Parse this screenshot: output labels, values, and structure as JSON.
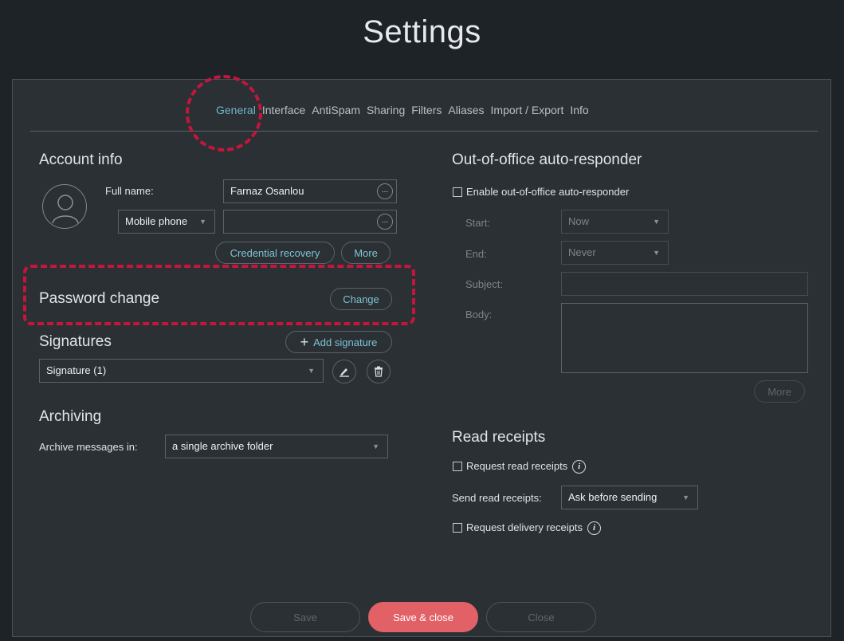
{
  "title": "Settings",
  "tabs": [
    {
      "label": "General",
      "active": true
    },
    {
      "label": "Interface",
      "active": false
    },
    {
      "label": "AntiSpam",
      "active": false
    },
    {
      "label": "Sharing",
      "active": false
    },
    {
      "label": "Filters",
      "active": false
    },
    {
      "label": "Aliases",
      "active": false
    },
    {
      "label": "Import / Export",
      "active": false
    },
    {
      "label": "Info",
      "active": false
    }
  ],
  "account": {
    "heading": "Account info",
    "full_name_label": "Full name:",
    "full_name_value": "Farnaz Osanlou",
    "ellipsis": "...",
    "phone_type": "Mobile phone",
    "phone_value": "",
    "credential_recovery": "Credential recovery",
    "more": "More"
  },
  "password": {
    "heading": "Password change",
    "change": "Change"
  },
  "signatures": {
    "heading": "Signatures",
    "add": "Add signature",
    "selected": "Signature (1)"
  },
  "archiving": {
    "heading": "Archiving",
    "label": "Archive messages in:",
    "value": "a single archive folder"
  },
  "ooo": {
    "heading": "Out-of-office auto-responder",
    "enable_label": "Enable out-of-office auto-responder",
    "enabled": false,
    "start_label": "Start:",
    "start_value": "Now",
    "end_label": "End:",
    "end_value": "Never",
    "subject_label": "Subject:",
    "body_label": "Body:",
    "more": "More"
  },
  "read_receipts": {
    "heading": "Read receipts",
    "request_label": "Request read receipts",
    "request_checked": false,
    "send_label": "Send read receipts:",
    "send_value": "Ask before sending",
    "delivery_label": "Request delivery receipts",
    "delivery_checked": false
  },
  "footer": {
    "save": "Save",
    "save_close": "Save & close",
    "close": "Close"
  },
  "colors": {
    "accent": "#6fb6c8",
    "primary_button": "#e16167",
    "highlight": "#c4163c"
  }
}
